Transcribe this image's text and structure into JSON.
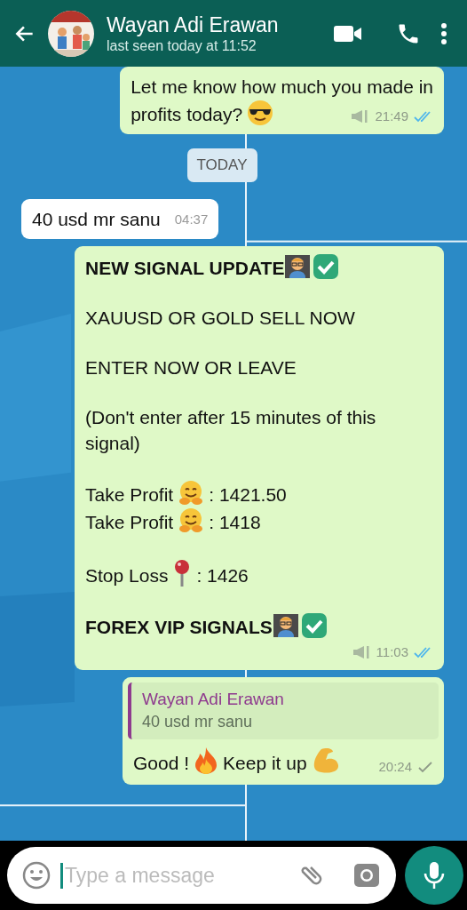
{
  "header": {
    "contact_name": "Wayan Adi Erawan",
    "status": "last seen today at 11:52"
  },
  "messages": [
    {
      "kind": "outgoing",
      "paragraphs": [
        [
          {
            "parts": [
              {
                "kind": "text",
                "text": "Let me know how much you made in"
              }
            ]
          },
          {
            "parts": [
              {
                "kind": "text",
                "text": "profits today?"
              },
              {
                "kind": "sunglasses"
              }
            ]
          }
        ]
      ],
      "time": "21:49",
      "broadcast": true,
      "read": true
    },
    {
      "kind": "date",
      "text": "TODAY"
    },
    {
      "kind": "incoming",
      "paragraphs": [
        [
          {
            "parts": [
              {
                "kind": "text",
                "text": "40 usd mr sanu"
              }
            ]
          }
        ]
      ],
      "time": "04:37"
    },
    {
      "kind": "outgoing",
      "paragraphs": [
        [
          {
            "bold": true,
            "parts": [
              {
                "kind": "text",
                "text": "NEW SIGNAL UPDATE"
              },
              {
                "kind": "teacher"
              },
              {
                "kind": "check"
              }
            ]
          }
        ],
        [
          {
            "parts": [
              {
                "kind": "text",
                "text": "XAUUSD OR GOLD SELL NOW"
              }
            ]
          }
        ],
        [
          {
            "parts": [
              {
                "kind": "text",
                "text": "ENTER NOW OR LEAVE"
              }
            ]
          }
        ],
        [
          {
            "parts": [
              {
                "kind": "text",
                "text": "(Don't enter after 15 minutes of this signal)"
              }
            ]
          }
        ],
        [
          {
            "parts": [
              {
                "kind": "text",
                "text": "Take Profit"
              },
              {
                "kind": "hug"
              },
              {
                "kind": "text",
                "text": ": 1421.50"
              }
            ]
          },
          {
            "parts": [
              {
                "kind": "text",
                "text": "Take Profit"
              },
              {
                "kind": "hug"
              },
              {
                "kind": "text",
                "text": ": 1418"
              }
            ]
          }
        ],
        [
          {
            "parts": [
              {
                "kind": "text",
                "text": "Stop Loss"
              },
              {
                "kind": "pin"
              },
              {
                "kind": "text",
                "text": ": 1426"
              }
            ]
          }
        ],
        [
          {
            "bold": true,
            "parts": [
              {
                "kind": "text",
                "text": "FOREX VIP SIGNALS"
              },
              {
                "kind": "teacher"
              },
              {
                "kind": "check"
              }
            ]
          }
        ]
      ],
      "time": "11:03",
      "broadcast": true,
      "read": true
    },
    {
      "kind": "outgoing",
      "quote": {
        "author": "Wayan Adi Erawan",
        "text": "40 usd mr sanu"
      },
      "paragraphs": [
        [
          {
            "parts": [
              {
                "kind": "text",
                "text": "Good !"
              },
              {
                "kind": "fire"
              },
              {
                "kind": "text",
                "text": "Keep it up"
              },
              {
                "kind": "muscle"
              }
            ]
          }
        ]
      ],
      "time": "20:24",
      "broadcast": false,
      "read": false
    }
  ],
  "composer": {
    "placeholder": "Type a message"
  }
}
